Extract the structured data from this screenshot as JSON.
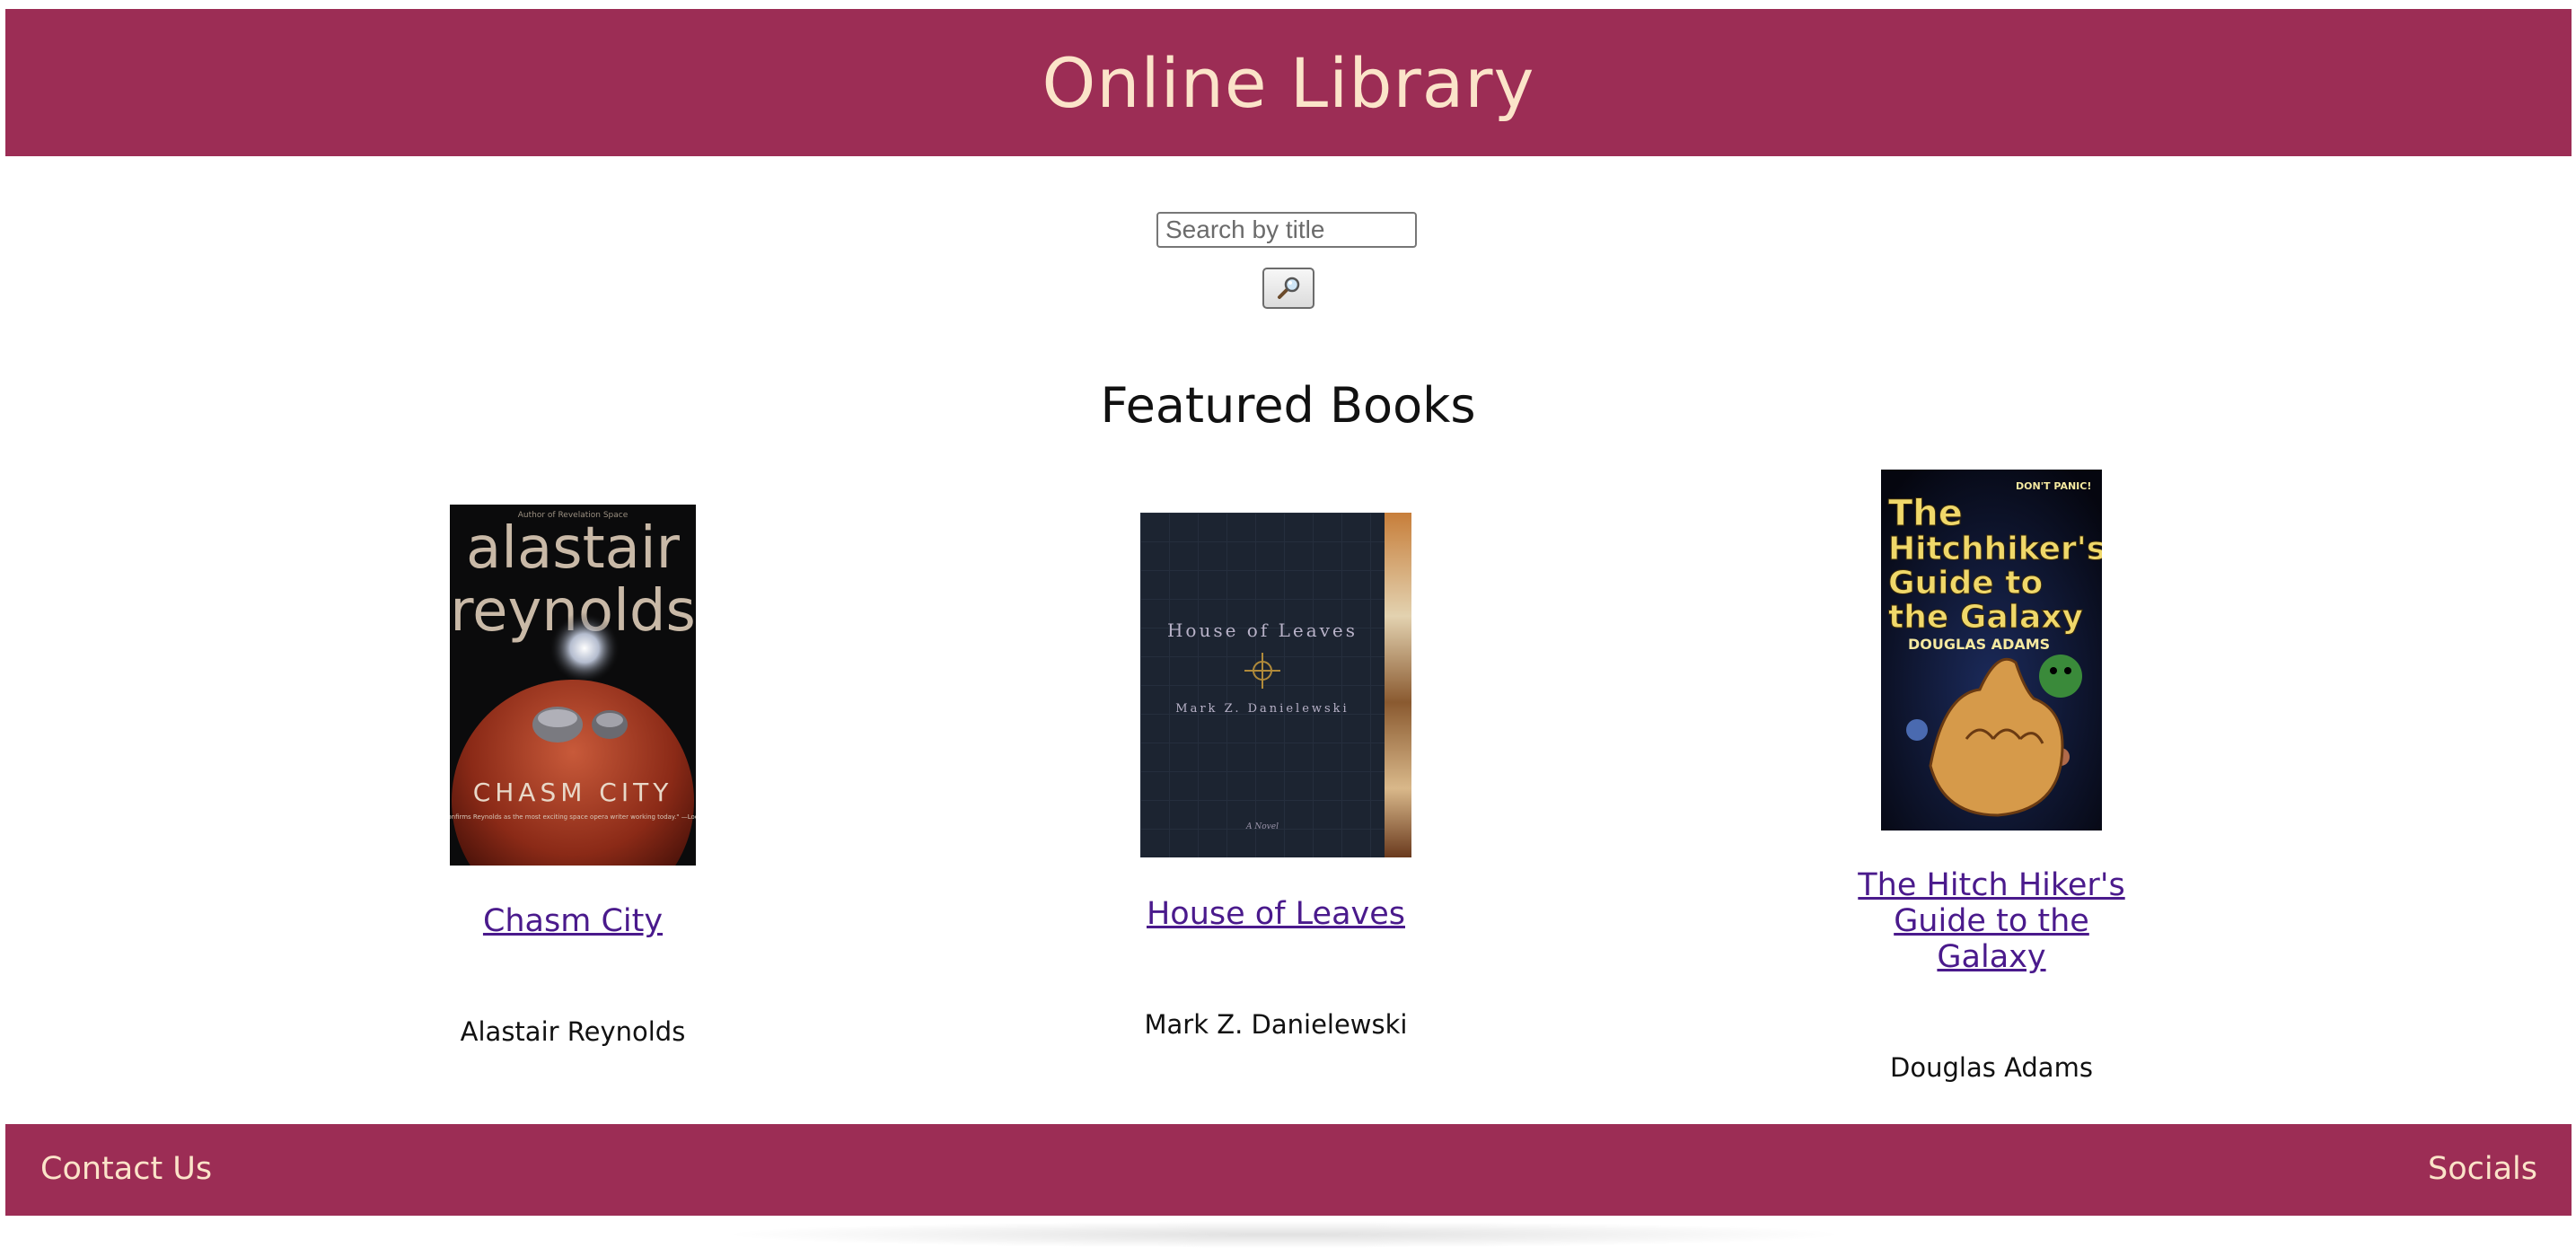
{
  "header": {
    "title": "Online Library"
  },
  "search": {
    "placeholder": "Search by title",
    "value": "",
    "button_icon": "magnifying-glass-icon"
  },
  "featured": {
    "heading": "Featured Books",
    "books": [
      {
        "title": "Chasm City",
        "author": "Alastair Reynolds",
        "cover_text": {
          "author_first": "alastair",
          "author_last": "reynolds",
          "title": "CHASM CITY",
          "tagline_top": "Author of Revelation Space",
          "quote": "\"Confirms Reynolds as the most exciting space opera writer working today.\" —Locus"
        }
      },
      {
        "title": "House of Leaves",
        "author": "Mark Z. Danielewski",
        "cover_text": {
          "title": "House of Leaves",
          "author": "Mark Z. Danielewski",
          "subtitle": "A Novel"
        }
      },
      {
        "title": "The Hitch Hiker's Guide to the Galaxy",
        "author": "Douglas Adams",
        "cover_text": {
          "title_lines": [
            "The",
            "Hitchhiker's",
            "Guide to",
            "the Galaxy"
          ],
          "author": "DOUGLAS ADAMS",
          "top_line": "DON'T PANIC!"
        }
      }
    ]
  },
  "footer": {
    "contact_label": "Contact Us",
    "socials_label": "Socials"
  },
  "colors": {
    "brand": "#9c2d55",
    "brand_text": "#fbe4c9",
    "link": "#4a1a8c"
  }
}
